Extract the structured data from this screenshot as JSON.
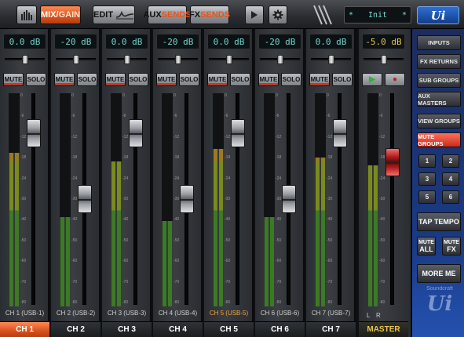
{
  "toolbar": {
    "meter_label": "meters",
    "mix_left": "MIX/",
    "mix_right": "GAIN",
    "edit_label": "EDIT",
    "aux_left": "AUX",
    "aux_right": "SENDS",
    "fx_left": "FX",
    "fx_right": "SENDS",
    "snapshot_left": "*",
    "snapshot_name": "Init",
    "snapshot_right": "*",
    "logo": "Ui"
  },
  "scale_marks": [
    "0",
    "-6",
    "-12",
    "-18",
    "-24",
    "-30",
    "-40",
    "-50",
    "-60",
    "-70",
    "-80"
  ],
  "channels": [
    {
      "gain": "0.0 dB",
      "pan": 0.5,
      "fader": 0.86,
      "meter": 0.72,
      "mute": "MUTE",
      "solo": "SOLO",
      "label": "CH 1 (USB-1)",
      "name": "CH 1",
      "selected": true
    },
    {
      "gain": "-20 dB",
      "pan": 0.5,
      "fader": 0.5,
      "meter": 0.42,
      "mute": "MUTE",
      "solo": "SOLO",
      "label": "CH 2 (USB-2)",
      "name": "CH 2",
      "selected": false
    },
    {
      "gain": "0.0 dB",
      "pan": 0.5,
      "fader": 0.86,
      "meter": 0.68,
      "mute": "MUTE",
      "solo": "SOLO",
      "label": "CH 3 (USB-3)",
      "name": "CH 3",
      "selected": false
    },
    {
      "gain": "-20 dB",
      "pan": 0.5,
      "fader": 0.5,
      "meter": 0.4,
      "mute": "MUTE",
      "solo": "SOLO",
      "label": "CH 4 (USB-4)",
      "name": "CH 4",
      "selected": false
    },
    {
      "gain": "0.0 dB",
      "pan": 0.5,
      "fader": 0.86,
      "meter": 0.74,
      "mute": "MUTE",
      "solo": "SOLO",
      "label": "CH 5 (USB-5)",
      "name": "CH 5",
      "selected": false,
      "highlight": true
    },
    {
      "gain": "-20 dB",
      "pan": 0.5,
      "fader": 0.5,
      "meter": 0.42,
      "mute": "MUTE",
      "solo": "SOLO",
      "label": "CH 6 (USB-6)",
      "name": "CH 6",
      "selected": false
    },
    {
      "gain": "0.0 dB",
      "pan": 0.5,
      "fader": 0.86,
      "meter": 0.7,
      "mute": "MUTE",
      "solo": "SOLO",
      "label": "CH 7 (USB-7)",
      "name": "CH 7",
      "selected": false
    }
  ],
  "master": {
    "gain": "-5.0 dB",
    "pan": 0.5,
    "fader": 0.7,
    "meter": 0.66,
    "play": "▶",
    "rec": "●",
    "left": "L",
    "right": "R",
    "name": "MASTER"
  },
  "sidebar": {
    "inputs": "INPUTS",
    "fx_returns": "FX RETURNS",
    "sub_groups": "SUB GROUPS",
    "aux_masters": "AUX MASTERS",
    "view_groups": "VIEW GROUPS",
    "mute_groups": "MUTE GROUPS",
    "groups": [
      "1",
      "2",
      "3",
      "4",
      "5",
      "6"
    ],
    "tap_tempo": "TAP TEMPO",
    "mute_label": "MUTE",
    "all_label": "ALL",
    "fx_label": "FX",
    "more_me": "MORE ME",
    "brand": "Soundcraft",
    "logo": "Ui"
  },
  "colors": {
    "accent": "#d9501d",
    "mute_active": "#c82d1e",
    "gain_text": "#74d7d0",
    "master_text": "#e8c64a"
  }
}
